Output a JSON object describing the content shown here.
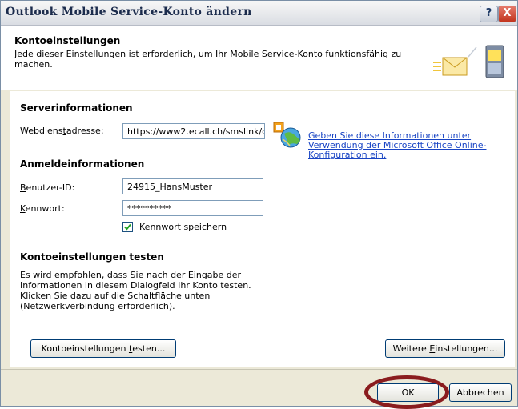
{
  "window": {
    "title": "Outlook Mobile Service-Konto ändern",
    "help": "?",
    "close": "X"
  },
  "header": {
    "title": "Kontoeinstellungen",
    "description": "Jede dieser Einstellungen ist erforderlich, um Ihr Mobile Service-Konto funktionsfähig zu machen."
  },
  "server": {
    "section": "Serverinformationen",
    "web_label": {
      "pre": "Webdiens",
      "acc": "t",
      "post": "adresse:"
    },
    "web_value": "https://www2.ecall.ch/smslink/c",
    "link": "Geben Sie diese Informationen unter Verwendung der Microsoft Office Online-Konfiguration ein."
  },
  "login": {
    "section": "Anmeldeinformationen",
    "user_label": {
      "acc": "B",
      "post": "enutzer-ID:"
    },
    "user_value": "24915_HansMuster",
    "pass_label": {
      "acc": "K",
      "post": "ennwort:"
    },
    "pass_value": "**********",
    "save_label": {
      "pre": "Ke",
      "acc": "n",
      "post": "nwort speichern"
    },
    "save_checked": true
  },
  "test": {
    "section": "Kontoeinstellungen testen",
    "description": "Es wird empfohlen, dass Sie nach der Eingabe der Informationen in diesem Dialogfeld Ihr Konto testen. Klicken Sie dazu auf die Schaltfläche unten (Netzwerkverbindung erforderlich).",
    "test_button": {
      "pre": "Kontoeinstellungen ",
      "acc": "t",
      "post": "esten..."
    },
    "more_button": {
      "pre": "Weitere ",
      "acc": "E",
      "post": "instellungen..."
    }
  },
  "footer": {
    "ok": "OK",
    "cancel": "Abbrechen"
  },
  "icons": {
    "header": "envelope-phone-icon",
    "globe": "globe-office-icon",
    "check": "checkmark-icon"
  }
}
